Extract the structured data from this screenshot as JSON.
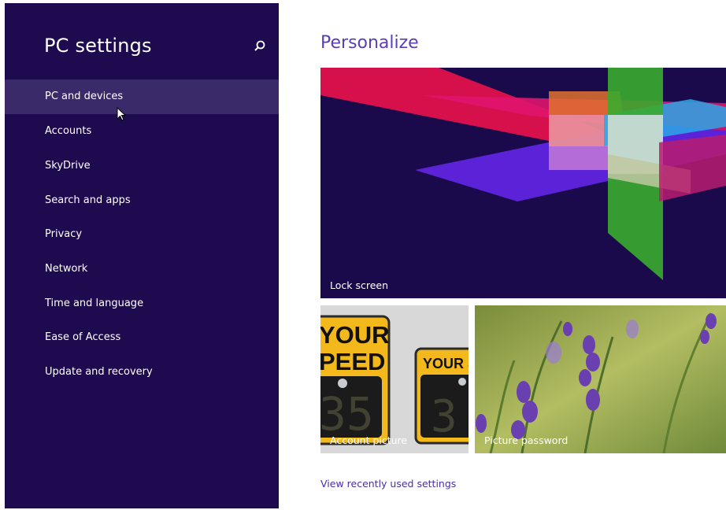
{
  "sidebar": {
    "title": "PC settings",
    "search_icon": "search-icon",
    "items": [
      {
        "label": "PC and devices",
        "selected": true
      },
      {
        "label": "Accounts"
      },
      {
        "label": "SkyDrive"
      },
      {
        "label": "Search and apps"
      },
      {
        "label": "Privacy"
      },
      {
        "label": "Network"
      },
      {
        "label": "Time and language"
      },
      {
        "label": "Ease of Access"
      },
      {
        "label": "Update and recovery"
      }
    ]
  },
  "main": {
    "title": "Personalize",
    "tiles": {
      "lock_screen": "Lock screen",
      "account_picture": "Account picture",
      "picture_password": "Picture password"
    },
    "account_picture_sign_text": [
      "YOUR",
      "PEED",
      "YOUR S",
      "35",
      "3"
    ],
    "link": "View recently used settings"
  },
  "colors": {
    "sidebar_bg": "#1e0a4e",
    "selected_item_bg": "#3b2a6a",
    "accent": "#5b3db8"
  }
}
